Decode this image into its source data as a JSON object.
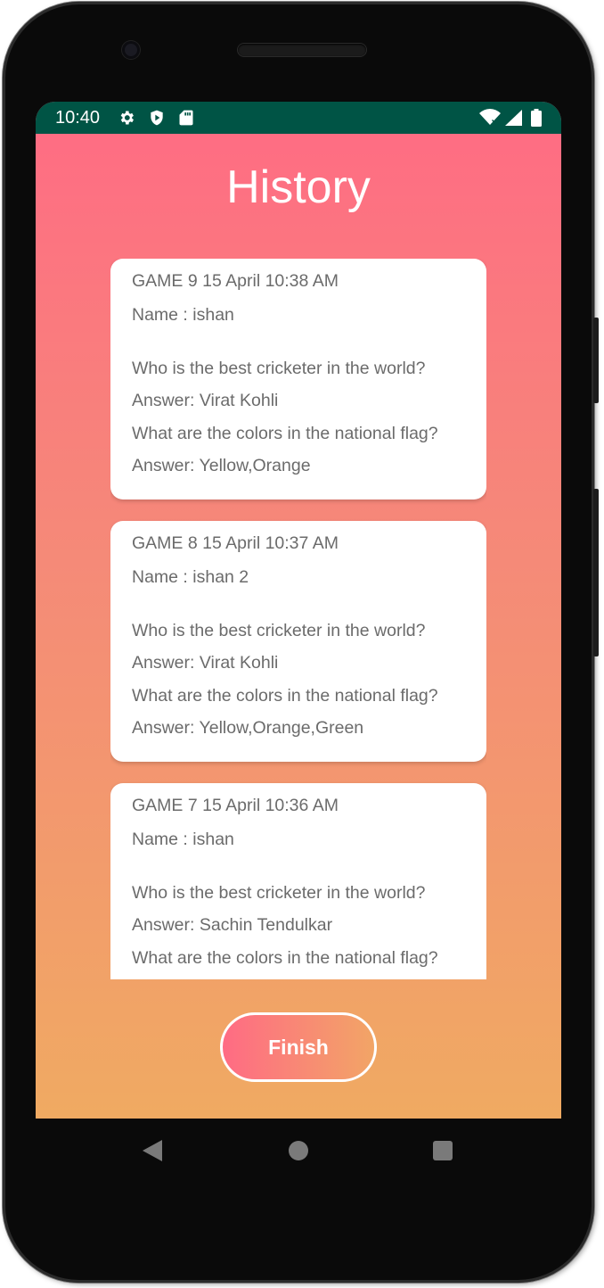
{
  "status_bar": {
    "time": "10:40",
    "left_icons": [
      "gear-icon",
      "shield-play-icon",
      "sd-card-icon"
    ],
    "right_icons": [
      "wifi-icon",
      "signal-icon",
      "battery-icon"
    ],
    "background_color": "#005445"
  },
  "page": {
    "title": "History",
    "gradient_top": "#ff6b84",
    "gradient_bottom": "#f0aa62"
  },
  "history": [
    {
      "header": "GAME 9 15 April 10:38 AM",
      "name": "Name : ishan",
      "q1": "Who is the best cricketer in the world?",
      "a1": "Answer: Virat Kohli",
      "q2": "What are the colors in the national flag?",
      "a2": "Answer: Yellow,Orange"
    },
    {
      "header": "GAME 8 15 April 10:37 AM",
      "name": "Name : ishan 2",
      "q1": "Who is the best cricketer in the world?",
      "a1": "Answer: Virat Kohli",
      "q2": "What are the colors in the national flag?",
      "a2": "Answer: Yellow,Orange,Green"
    },
    {
      "header": "GAME 7 15 April 10:36 AM",
      "name": "Name : ishan",
      "q1": "Who is the best cricketer in the world?",
      "a1": "Answer: Sachin Tendulkar",
      "q2": "What are the colors in the national flag?"
    }
  ],
  "finish_button": {
    "label": "Finish"
  },
  "nav_bar": {
    "icons": [
      "back-icon",
      "home-icon",
      "recents-icon"
    ]
  }
}
